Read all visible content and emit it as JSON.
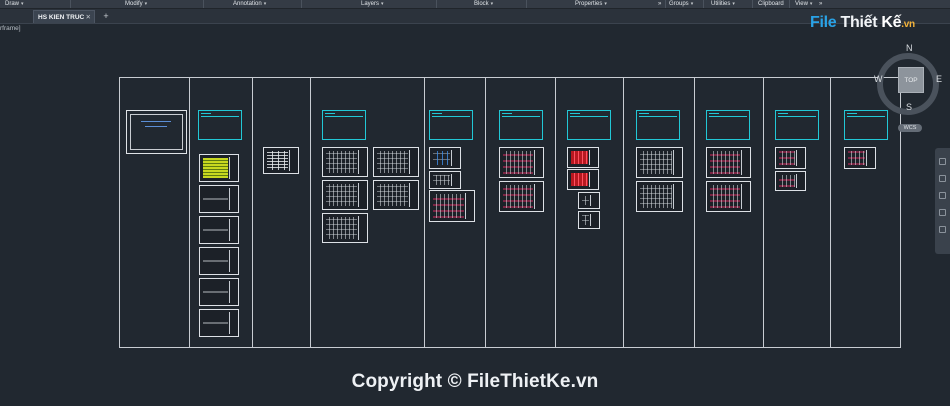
{
  "ribbon": {
    "panels": [
      {
        "label": "Draw",
        "caret": "▾"
      },
      {
        "label": "Modify",
        "caret": "▾"
      },
      {
        "label": "Annotation",
        "caret": "▾"
      },
      {
        "label": "Layers",
        "caret": "▾"
      },
      {
        "label": "Block",
        "caret": "▾"
      },
      {
        "label": "Properties",
        "caret": "▾"
      },
      {
        "label": "Groups",
        "caret": "▾"
      },
      {
        "label": "Utilities",
        "caret": "▾"
      },
      {
        "label": "Clipboard",
        "caret": ""
      },
      {
        "label": "View",
        "caret": "▾"
      }
    ],
    "properties_pin": "»",
    "view_pin": "»"
  },
  "tabs": {
    "active_label": "HS KIEN TRUC",
    "close_glyph": "✕",
    "add_glyph": "+"
  },
  "viewport": {
    "label": "rframe]"
  },
  "logo": {
    "part1": "File",
    "part2": "Thiết",
    "part3": "Kế",
    "part4": ".vn"
  },
  "viewcube": {
    "top": "TOP",
    "north": "N",
    "south": "S",
    "east": "E",
    "west": "W",
    "wcs": "WCS"
  },
  "watermark": {
    "text": "Copyright © FileThietKe.vn"
  },
  "colors": {
    "background": "#212830",
    "title_block": "#22c8d6",
    "frame": "#c8ccd2",
    "accent": "#29a2e6"
  }
}
